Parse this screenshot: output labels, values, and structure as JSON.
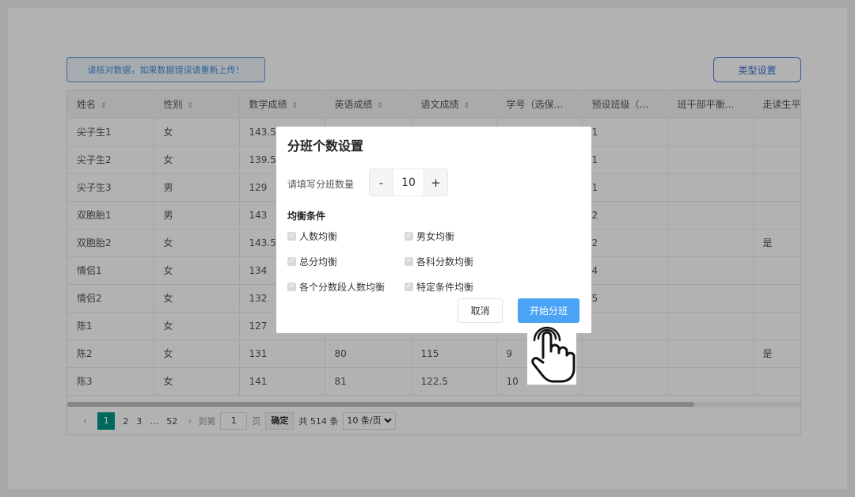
{
  "notice": "请核对数据，如果数据错误请重新上传！",
  "type_button": "类型设置",
  "table": {
    "headers": [
      "姓名",
      "性别",
      "数学成绩",
      "英语成绩",
      "语文成绩",
      "学号（选保…",
      "预设班级（…",
      "班干部平衡…",
      "走读生平"
    ],
    "sortable": [
      true,
      true,
      true,
      true,
      true,
      false,
      false,
      false,
      false
    ],
    "rows": [
      [
        "尖子生1",
        "女",
        "143.5",
        "",
        "",
        "",
        "1",
        "",
        ""
      ],
      [
        "尖子生2",
        "女",
        "139.5",
        "",
        "",
        "",
        "1",
        "",
        ""
      ],
      [
        "尖子生3",
        "男",
        "129",
        "",
        "",
        "",
        "1",
        "",
        ""
      ],
      [
        "双胞胎1",
        "男",
        "143",
        "",
        "",
        "",
        "2",
        "",
        ""
      ],
      [
        "双胞胎2",
        "女",
        "143.5",
        "",
        "",
        "",
        "2",
        "",
        "是"
      ],
      [
        "情侣1",
        "女",
        "134",
        "",
        "",
        "",
        "4",
        "",
        ""
      ],
      [
        "情侣2",
        "女",
        "132",
        "",
        "",
        "",
        "5",
        "",
        ""
      ],
      [
        "陈1",
        "女",
        "127",
        "",
        "",
        "",
        "",
        "",
        ""
      ],
      [
        "陈2",
        "女",
        "131",
        "80",
        "115",
        "9",
        "",
        "",
        "是"
      ],
      [
        "陈3",
        "女",
        "141",
        "81",
        "122.5",
        "10",
        "",
        "",
        ""
      ]
    ]
  },
  "pager": {
    "prev": "‹",
    "current": "1",
    "pages": [
      "2",
      "3"
    ],
    "ellipsis": "…",
    "last": "52",
    "next": "›",
    "goto_label": "到第",
    "goto_value": "1",
    "page_unit": "页",
    "confirm": "确定",
    "total": "共 514 条",
    "page_size": "10 条/页"
  },
  "dialog": {
    "title": "分班个数设置",
    "count_label": "请填写分班数量",
    "minus": "-",
    "value": "10",
    "plus": "+",
    "conditions_title": "均衡条件",
    "conditions": [
      "人数均衡",
      "男女均衡",
      "总分均衡",
      "各科分数均衡",
      "各个分数段人数均衡",
      "特定条件均衡"
    ],
    "cancel": "取消",
    "start": "开始分班"
  },
  "colors": {
    "primary": "#4aa3f5",
    "pager_active": "#009688",
    "notice_border": "#5b9bd5"
  }
}
